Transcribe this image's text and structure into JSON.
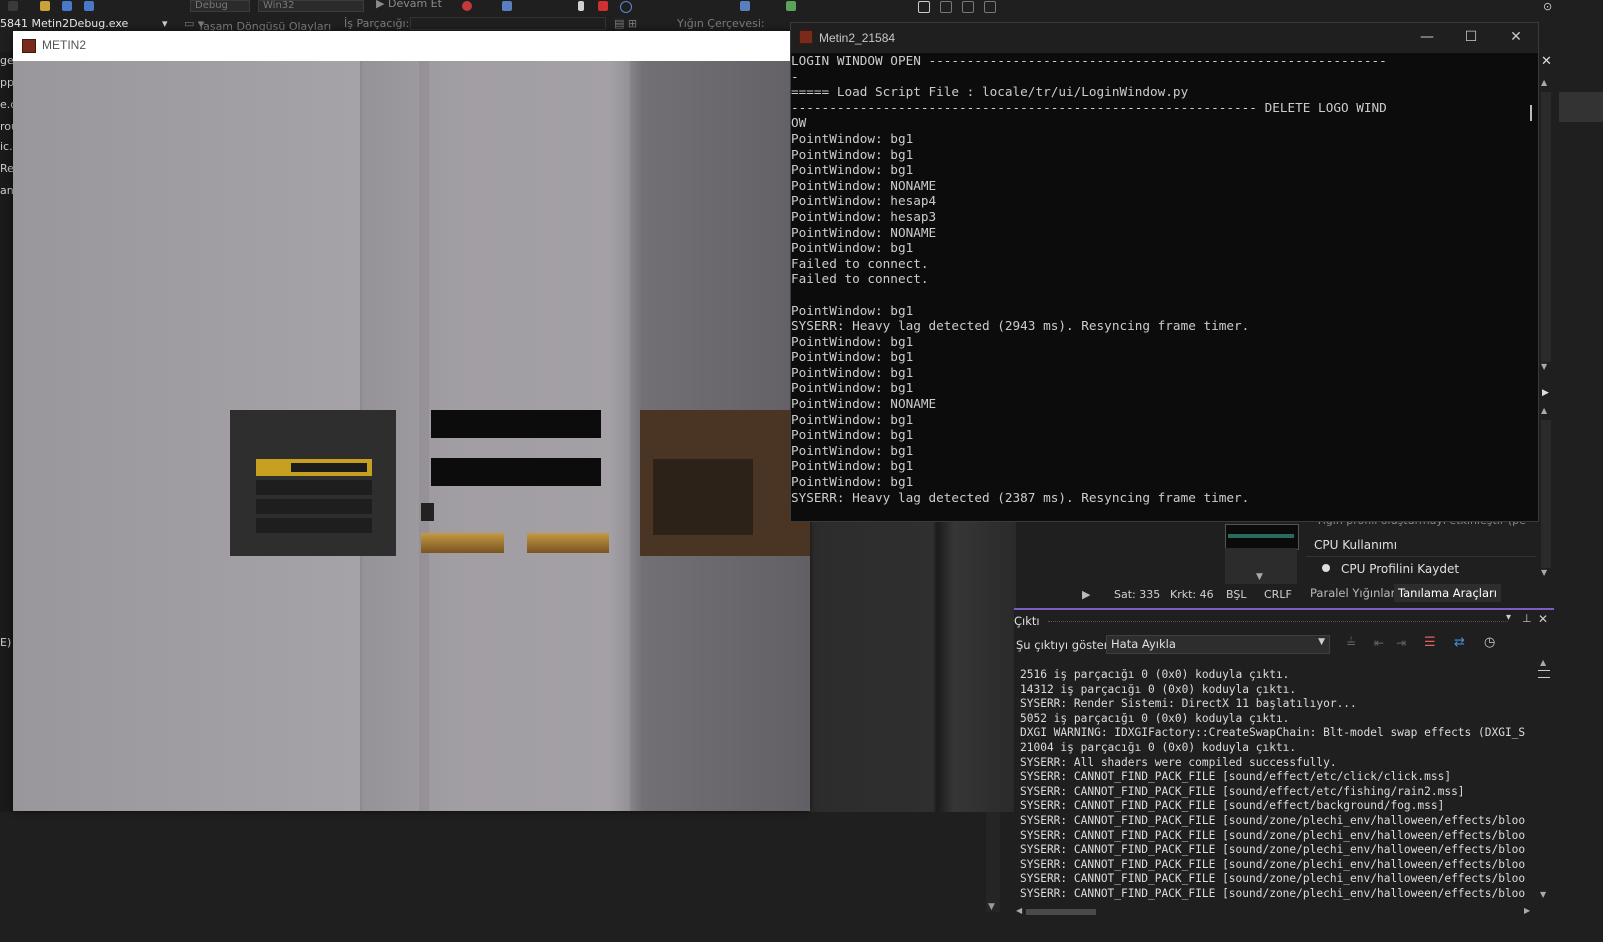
{
  "toolbar": {
    "config": "Debug",
    "platform": "Win32",
    "continue_label": "Devam Et",
    "process": "5841 Metin2Debug.exe",
    "lifecycle_events": "Yaşam Döngüsü Olayları",
    "thread": "İş Parçacığı:",
    "stack_frame": "Yığın Çerçevesi:"
  },
  "left_strip": [
    "ger",
    "pp",
    "e.c",
    "rou",
    "ic.l",
    "Re",
    "an",
    "E)"
  ],
  "game_window": {
    "title": "METIN2"
  },
  "console_window": {
    "title": "Metin2_21584",
    "lines": [
      "LOGIN WINDOW OPEN ------------------------------------------------------------",
      "-",
      "===== Load Script File : locale/tr/ui/LoginWindow.py",
      "------------------------------------------------------------- DELETE LOGO WIND",
      "OW",
      "PointWindow: bg1",
      "PointWindow: bg1",
      "PointWindow: bg1",
      "PointWindow: NONAME",
      "PointWindow: hesap4",
      "PointWindow: hesap3",
      "PointWindow: NONAME",
      "PointWindow: bg1",
      "Failed to connect.",
      "Failed to connect.",
      "",
      "PointWindow: bg1",
      "SYSERR: Heavy lag detected (2943 ms). Resyncing frame timer.",
      "PointWindow: bg1",
      "PointWindow: bg1",
      "PointWindow: bg1",
      "PointWindow: bg1",
      "PointWindow: NONAME",
      "PointWindow: bg1",
      "PointWindow: bg1",
      "PointWindow: bg1",
      "PointWindow: bg1",
      "PointWindow: bg1",
      "SYSERR: Heavy lag detected (2387 ms). Resyncing frame timer."
    ]
  },
  "diagnostics": {
    "event_text": "Yığın profili oluşturmayı etkinleştir (pe",
    "cpu_usage": "CPU Kullanımı",
    "cpu_profile": "CPU Profilini Kaydet",
    "tab_parallel": "Paralel Yığınlar",
    "tab_diag": "Tanılama Araçları"
  },
  "status_bar": {
    "line": "Sat: 335",
    "col": "Krkt: 46",
    "ins": "BŞL",
    "eol": "CRLF"
  },
  "output_panel": {
    "title": "Çıktı",
    "show_label": "Şu çıktıyı göster:",
    "selected": "Hata Ayıkla",
    "lines": [
      "2516 iş parçacığı 0 (0x0) koduyla çıktı.",
      "14312 iş parçacığı 0 (0x0) koduyla çıktı.",
      "SYSERR: Render Sistemi: DirectX 11 başlatılıyor...",
      "5052 iş parçacığı 0 (0x0) koduyla çıktı.",
      "DXGI WARNING: IDXGIFactory::CreateSwapChain: Blt-model swap effects (DXGI_S",
      "21004 iş parçacığı 0 (0x0) koduyla çıktı.",
      "SYSERR: All shaders were compiled successfully.",
      "SYSERR: CANNOT_FIND_PACK_FILE [sound/effect/etc/click/click.mss]",
      "SYSERR: CANNOT_FIND_PACK_FILE [sound/effect/etc/fishing/rain2.mss]",
      "SYSERR: CANNOT_FIND_PACK_FILE [sound/effect/background/fog.mss]",
      "SYSERR: CANNOT_FIND_PACK_FILE [sound/zone/plechi_env/halloween/effects/bloo",
      "SYSERR: CANNOT_FIND_PACK_FILE [sound/zone/plechi_env/halloween/effects/bloo",
      "SYSERR: CANNOT_FIND_PACK_FILE [sound/zone/plechi_env/halloween/effects/bloo",
      "SYSERR: CANNOT_FIND_PACK_FILE [sound/zone/plechi_env/halloween/effects/bloo",
      "SYSERR: CANNOT_FIND_PACK_FILE [sound/zone/plechi_env/halloween/effects/bloo",
      "SYSERR: CANNOT_FIND_PACK_FILE [sound/zone/plechi_env/halloween/effects/bloo"
    ]
  },
  "colors": {
    "accent": "#7b5dc5",
    "console_bg": "#0c0c0c",
    "vs_bg": "#1f1f1f"
  }
}
